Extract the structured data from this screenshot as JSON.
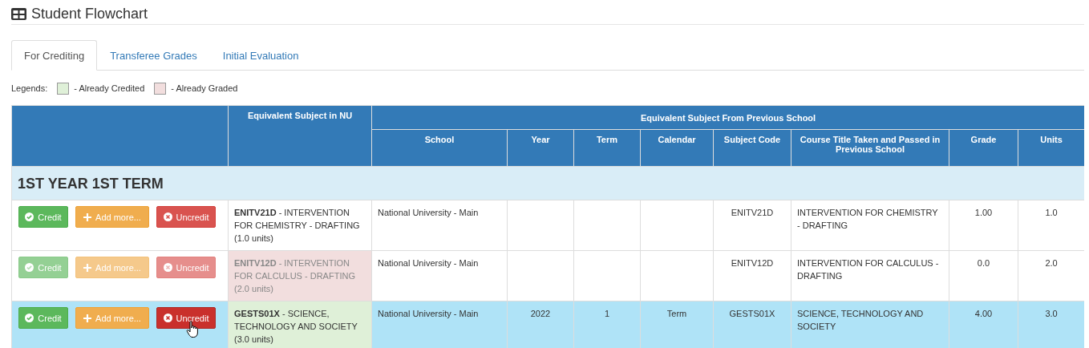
{
  "page": {
    "title": "Student Flowchart"
  },
  "tabs": [
    {
      "label": "For Crediting",
      "selected": true
    },
    {
      "label": "Transferee Grades",
      "selected": false
    },
    {
      "label": "Initial Evaluation",
      "selected": false
    }
  ],
  "legends": {
    "label": "Legends:",
    "items": [
      {
        "label": "- Already Credited",
        "color": "#dff0d8"
      },
      {
        "label": "- Already Graded",
        "color": "#f2dede"
      }
    ]
  },
  "table": {
    "group_headers": [
      "Equivalent Subject in NU",
      "Equivalent Subject From Previous School"
    ],
    "columns": [
      "School",
      "Year",
      "Term",
      "Calendar",
      "Subject Code",
      "Course Title Taken and Passed in Previous School",
      "Grade",
      "Units"
    ],
    "sections": [
      {
        "title": "1ST YEAR 1ST TERM",
        "rows": [
          {
            "selected": false,
            "buttons_disabled": false,
            "buttons": [
              {
                "kind": "credit",
                "label": "Credit",
                "hovered": false
              },
              {
                "kind": "add",
                "label": "Add more...",
                "hovered": false
              },
              {
                "kind": "uncredit",
                "label": "Uncredit",
                "hovered": false
              }
            ],
            "subject": {
              "credited": false,
              "graded": false,
              "text": "**ENITV21D** - INTERVENTION FOR CHEMISTRY - DRAFTING",
              "units": "(1.0 units)"
            },
            "cells": [
              "National University - Main",
              "",
              "",
              "",
              "ENITV21D",
              "INTERVENTION FOR CHEMISTRY - DRAFTING",
              "1.00",
              "1.0"
            ]
          },
          {
            "selected": false,
            "buttons_disabled": true,
            "buttons": [
              {
                "kind": "credit",
                "label": "Credit",
                "hovered": false
              },
              {
                "kind": "add",
                "label": "Add more...",
                "hovered": false
              },
              {
                "kind": "uncredit",
                "label": "Uncredit",
                "hovered": false
              }
            ],
            "subject": {
              "credited": false,
              "graded": true,
              "text": "**ENITV12D** - INTERVENTION FOR CALCULUS - DRAFTING",
              "units": "(2.0 units)"
            },
            "cells": [
              "National University - Main",
              "",
              "",
              "",
              "ENITV12D",
              "INTERVENTION FOR CALCULUS - DRAFTING",
              "0.0",
              "2.0"
            ]
          },
          {
            "selected": true,
            "buttons_disabled": false,
            "buttons": [
              {
                "kind": "credit",
                "label": "Credit",
                "hovered": false
              },
              {
                "kind": "add",
                "label": "Add more...",
                "hovered": false
              },
              {
                "kind": "uncredit",
                "label": "Uncredit",
                "hovered": true
              }
            ],
            "subject": {
              "credited": true,
              "graded": false,
              "text": "**GESTS01X** - SCIENCE, TECHNOLOGY AND SOCIETY",
              "units": "(3.0 units)"
            },
            "cells": [
              "National University - Main",
              "2022",
              "1",
              "Term",
              "GESTS01X",
              "SCIENCE, TECHNOLOGY AND SOCIETY",
              "4.00",
              "3.0"
            ]
          }
        ]
      }
    ]
  }
}
